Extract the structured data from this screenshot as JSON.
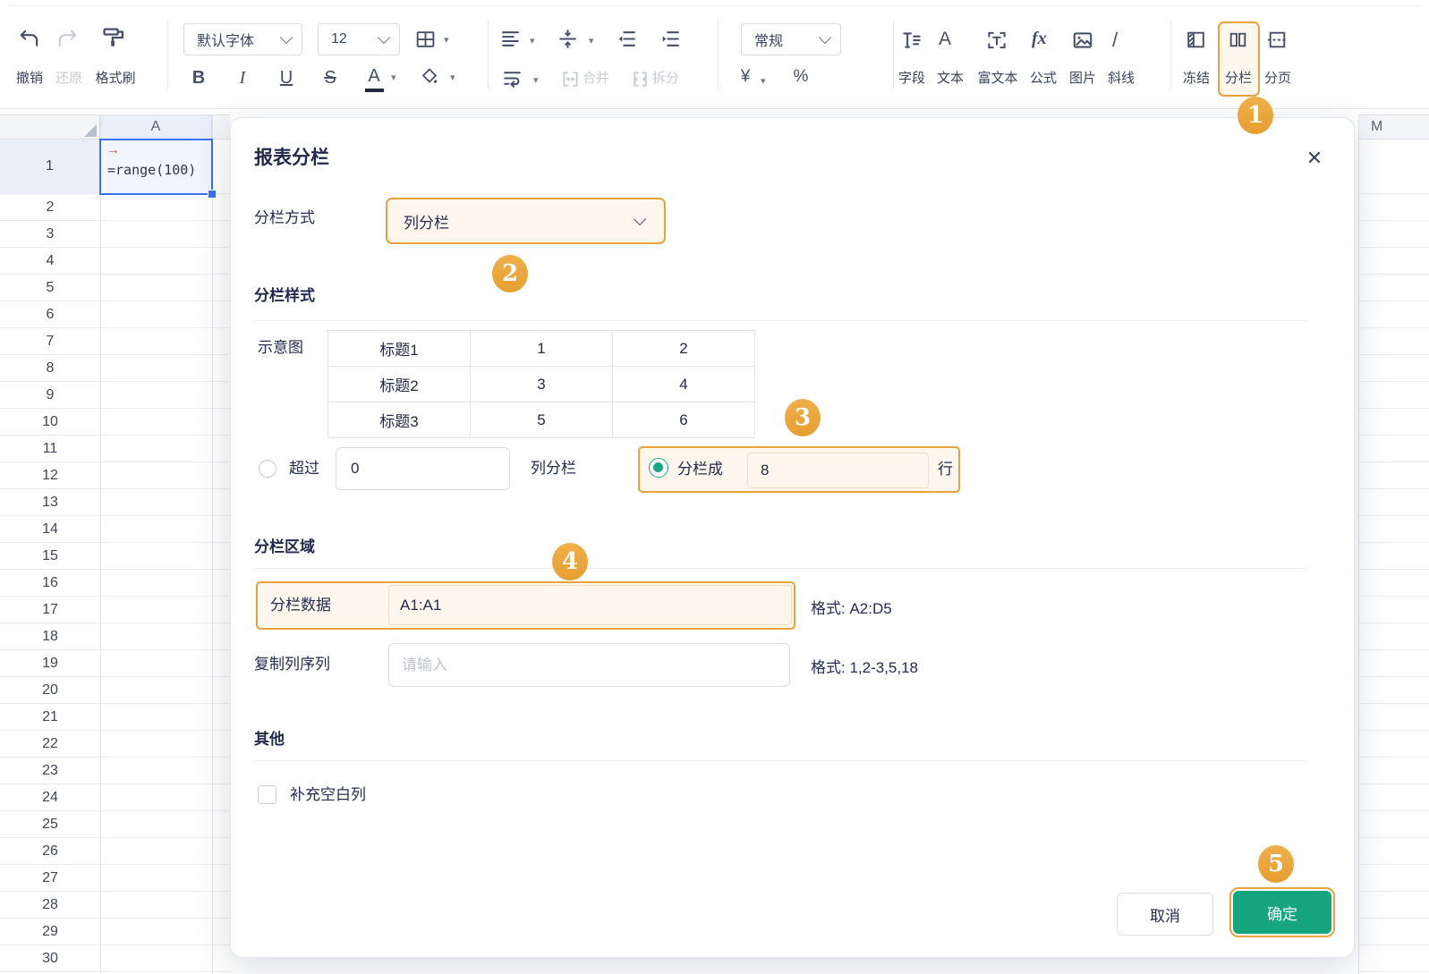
{
  "colors": {
    "accent_orange": "#E8A33D",
    "highlight_bg": "#FDF6EC",
    "primary_green": "#16A57F",
    "selection_blue": "#3B71F5",
    "text_navy": "#242C51"
  },
  "toolbar": {
    "undo": "撤销",
    "redo": "还原",
    "format_painter": "格式刷",
    "font_family": "默认字体",
    "font_size": "12",
    "bold": "B",
    "italic": "I",
    "underline": "U",
    "strikethrough": "S",
    "font_color": "A",
    "merge": "合并",
    "split": "拆分",
    "number_format": "常规",
    "currency": "¥",
    "percent": "%",
    "insert_items": [
      {
        "label": "字段"
      },
      {
        "label": "文本"
      },
      {
        "label": "富文本"
      },
      {
        "label": "公式"
      },
      {
        "label": "图片"
      },
      {
        "label": "斜线"
      }
    ],
    "view_items": [
      {
        "label": "冻结"
      },
      {
        "label": "分栏"
      },
      {
        "label": "分页"
      }
    ]
  },
  "sheet": {
    "visible_columns": [
      "A",
      "M"
    ],
    "row_count": 30,
    "a1_formula": "=range(100)",
    "a1_arrow": "→"
  },
  "dialog": {
    "title": "报表分栏",
    "close": "✕",
    "method_label": "分栏方式",
    "method_value": "列分栏",
    "style_section": "分栏样式",
    "preview_label": "示意图",
    "preview_rows": [
      [
        "标题1",
        "1",
        "2"
      ],
      [
        "标题2",
        "3",
        "4"
      ],
      [
        "标题3",
        "5",
        "6"
      ]
    ],
    "over_label": "超过",
    "over_value": "0",
    "over_unit": "列分栏",
    "split_label": "分栏成",
    "split_value": "8",
    "split_unit": "行",
    "area_section": "分栏区域",
    "data_label": "分栏数据",
    "data_value": "A1:A1",
    "data_hint": "格式: A2:D5",
    "copy_label": "复制列序列",
    "copy_placeholder": "请输入",
    "copy_hint": "格式: 1,2-3,5,18",
    "other_section": "其他",
    "fill_blank_label": "补充空白列",
    "cancel": "取消",
    "ok": "确定"
  },
  "step_badges": [
    "1",
    "2",
    "3",
    "4",
    "5"
  ]
}
